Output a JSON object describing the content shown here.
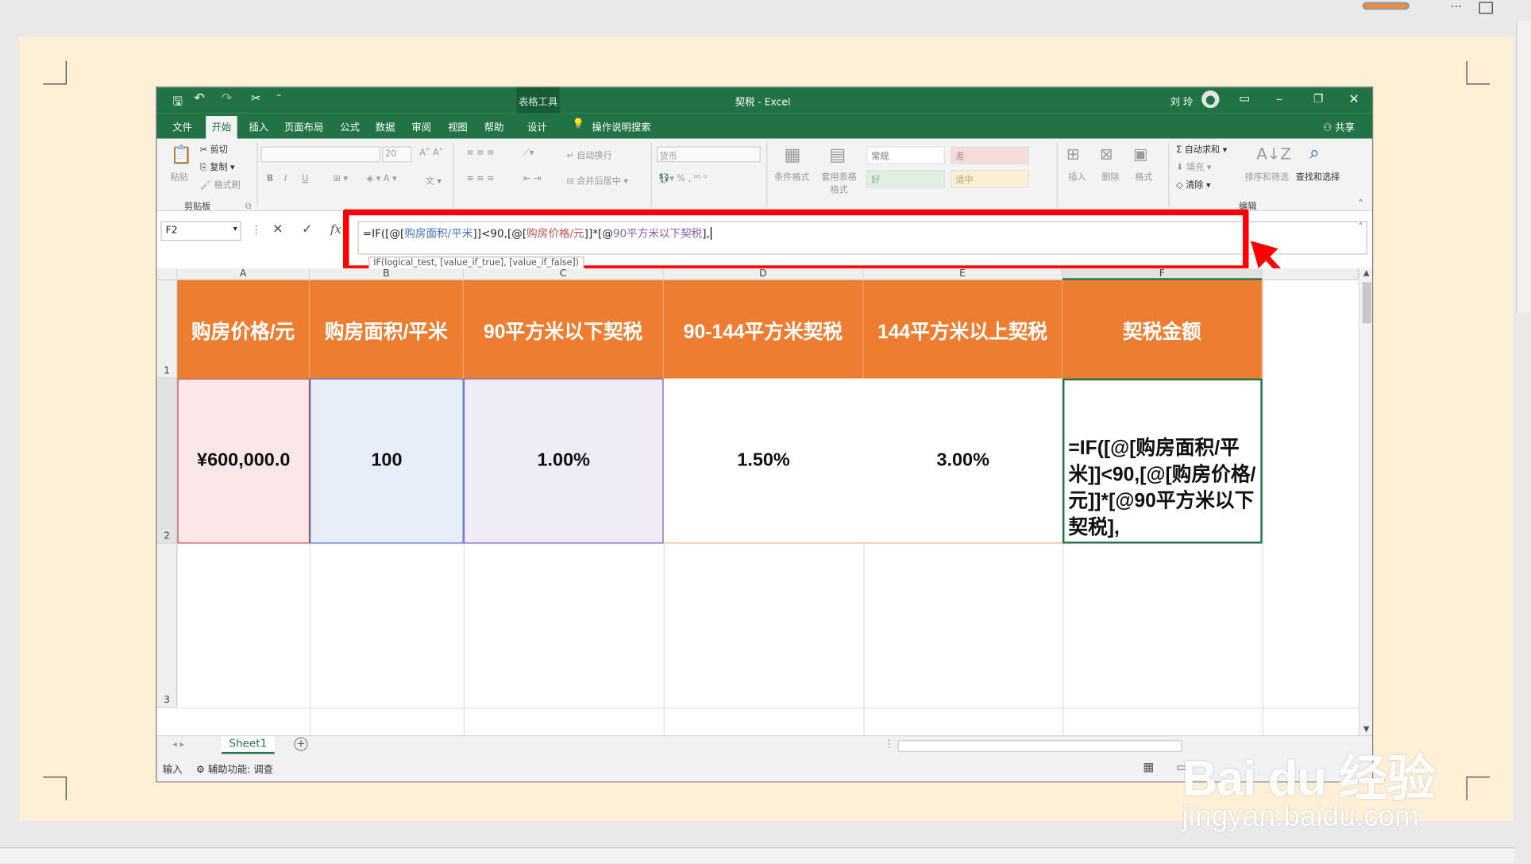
{
  "window": {
    "title": "契税 - Excel",
    "table_tools": "表格工具",
    "user": "刘 玲"
  },
  "tabs": [
    "文件",
    "开始",
    "插入",
    "页面布局",
    "公式",
    "数据",
    "审阅",
    "视图",
    "帮助",
    "设计"
  ],
  "tell_me": "操作说明搜索",
  "share": "共享",
  "ribbon": {
    "clipboard": {
      "paste": "粘贴",
      "cut": "剪切",
      "copy": "复制",
      "format_painter": "格式刷",
      "group": "剪贴板"
    },
    "font": {
      "size": "20",
      "bold": "B",
      "italic": "I",
      "underline": "U"
    },
    "alignment": {
      "wrap": "自动换行",
      "merge": "合并后居中"
    },
    "number": {
      "format": "货币"
    },
    "styles": {
      "conditional": "条件格式",
      "format_table": "套用表格格式",
      "normal": "常规",
      "bad": "差",
      "good": "好",
      "neutral": "适中"
    },
    "cells": {
      "insert": "插入",
      "delete": "删除",
      "format": "格式"
    },
    "editing": {
      "autosum": "自动求和",
      "fill": "填充",
      "clear": "清除",
      "sort": "排序和筛选",
      "find": "查找和选择",
      "group": "编辑"
    }
  },
  "formula_bar": {
    "name_box": "F2",
    "cancel": "✕",
    "enter": "✓",
    "fx": "fx",
    "formula_parts": [
      "=IF([@[",
      "购房面积/平米",
      "]]<90,[@[",
      "购房价格/元",
      "]]*[@",
      "90平方米以下契税",
      "],"
    ],
    "tooltip": "IF(logical_test, [value_if_true], [value_if_false])"
  },
  "columns": [
    "A",
    "B",
    "C",
    "D",
    "E",
    "F"
  ],
  "rows": [
    "1",
    "2",
    "3"
  ],
  "headers": [
    "购房价格/元",
    "购房面积/平米",
    "90平方米以下契税",
    "90-144平方米契税",
    "144平方米以上契税",
    "契税金额"
  ],
  "data_row": [
    "¥600,000.0",
    "100",
    "1.00%",
    "1.50%",
    "3.00%",
    "=IF([@[购房面积/平米]]<90,[@[购房价格/元]]*[@90平方米以下契税],"
  ],
  "sheet_tab": "Sheet1",
  "status": {
    "mode": "输入",
    "accessibility": "辅助功能: 调查"
  },
  "watermark": {
    "logo": "Bai du 经验",
    "url": "jingyan.baidu.com"
  },
  "colors": {
    "excel_green": "#217346",
    "header_orange": "#ed7d31",
    "highlight_red": "#ff0000",
    "paper": "#fdf0d6"
  }
}
